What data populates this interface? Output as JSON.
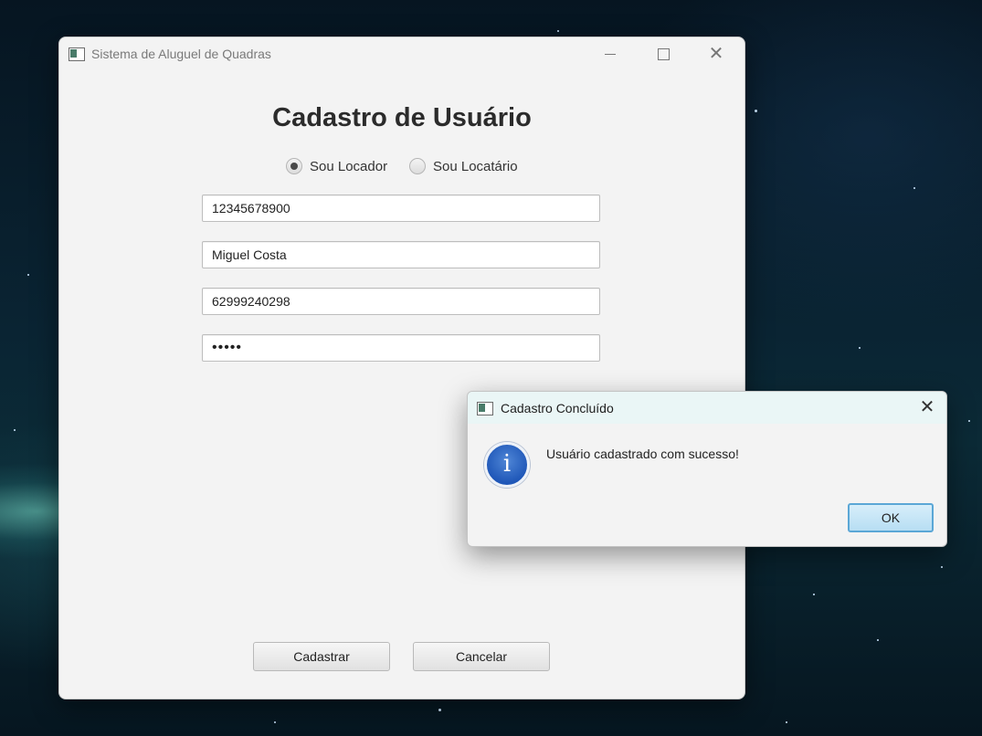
{
  "main_window": {
    "title": "Sistema de Aluguel de Quadras",
    "controls": {
      "minimize": "minimize",
      "maximize": "maximize",
      "close": "close"
    },
    "form": {
      "heading": "Cadastro de Usuário",
      "radios": [
        {
          "label": "Sou Locador",
          "checked": true
        },
        {
          "label": "Sou Locatário",
          "checked": false
        }
      ],
      "fields": {
        "cpf": "12345678900",
        "name": "Miguel Costa",
        "phone": "62999240298",
        "password_masked": "•••••"
      },
      "buttons": {
        "submit": "Cadastrar",
        "cancel": "Cancelar"
      }
    }
  },
  "dialog": {
    "title": "Cadastro Concluído",
    "icon": "info-icon",
    "icon_glyph": "i",
    "message": "Usuário cadastrado com sucesso!",
    "ok_label": "OK",
    "close_glyph": "✕"
  },
  "colors": {
    "dialog_title_bg": "#eaf6f6",
    "ok_border": "#5ba7d6",
    "info_blue": "#1f57b8"
  }
}
